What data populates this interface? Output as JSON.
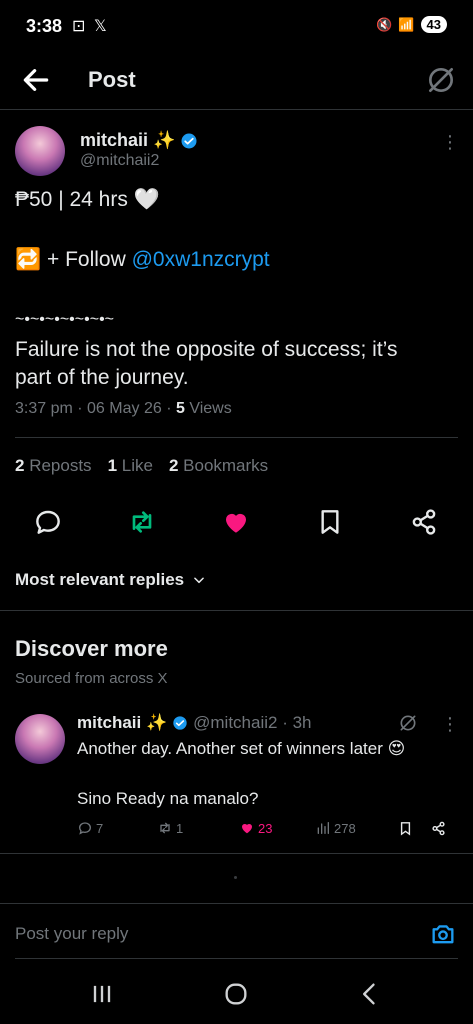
{
  "status_bar": {
    "time": "3:38",
    "left_icons": "⊡ 𝕏",
    "battery": "43"
  },
  "header": {
    "title": "Post"
  },
  "post": {
    "author_name": "mitchaii ✨",
    "author_handle": "@mitchaii2",
    "line1": "₱50 | 24 hrs 🤍",
    "line2_prefix": "🔁 + Follow ",
    "line2_link": "@0xw1nzcrypt",
    "line3": "~•~•~•~•~•~•~",
    "line4": "Failure is not the opposite of success; it’s",
    "line5": "part of the journey.",
    "timestamp": "3:37 pm · 06 May 26 · ",
    "views_count": "5",
    "views_label": " Views"
  },
  "stats": {
    "reposts_count": "2",
    "reposts_label": " Reposts",
    "likes_count": "1",
    "likes_label": " Like",
    "bookmarks_count": "2",
    "bookmarks_label": " Bookmarks"
  },
  "sort": {
    "label": "Most relevant replies"
  },
  "discover": {
    "title": "Discover more",
    "subtitle": "Sourced from across X"
  },
  "reply_post": {
    "author_name": "mitchaii ✨",
    "author_handle": "@mitchaii2 · 3h",
    "line1": "Another day. Another set of winners later 😍",
    "line2": "Sino Ready na manalo?",
    "replies": "7",
    "reposts": "1",
    "likes": "23",
    "views": "278"
  },
  "reply_input": {
    "placeholder": "Post your reply"
  },
  "colors": {
    "accent": "#1d9bf0",
    "like": "#f91880",
    "repost": "#00ba7c",
    "muted": "#71767b"
  }
}
